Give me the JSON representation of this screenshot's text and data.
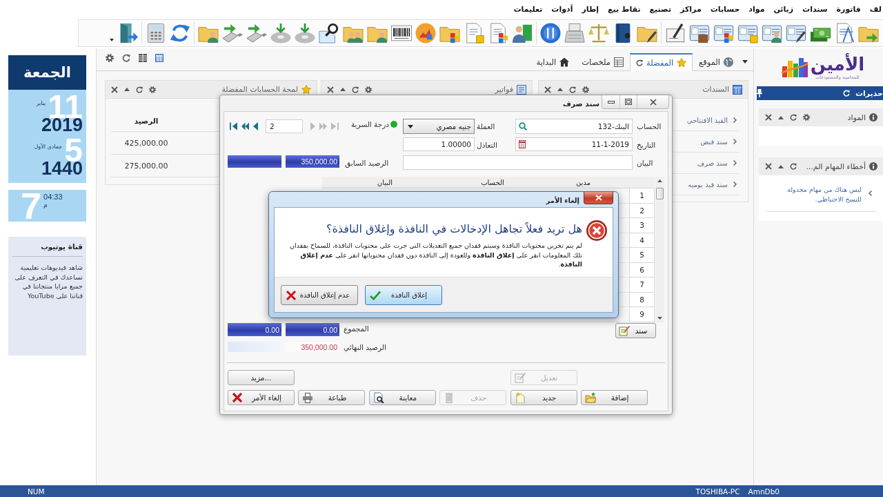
{
  "menu_bar": [
    "لف",
    "فاتورة",
    "سندات",
    "زبائن",
    "مواد",
    "حسابات",
    "مراكز",
    "تصنيع",
    "نقاط بيع",
    "إطار",
    "أدوات",
    "تعليمات"
  ],
  "calendar": {
    "weekday": "الجمعة",
    "gregorian": {
      "month": "يناير",
      "day": "11",
      "year": "2019"
    },
    "hijri": {
      "month": "جمادى الأول",
      "day": "5",
      "year": "1440"
    },
    "time": {
      "hour": "7",
      "clock": "04:33",
      "period": "م"
    }
  },
  "youtube_card": {
    "title": "قناة يوتيوب",
    "text": "شاهد فيديوهات تعليمية تساعدك في التعرف على جميع مزايا منتجاتنا في قناتنا على YouTube"
  },
  "tabs": [
    {
      "label": "الموقع",
      "selected": false
    },
    {
      "label": "المفضلة",
      "selected": true
    },
    {
      "label": "ملخصات",
      "selected": false
    },
    {
      "label": "البداية",
      "selected": false
    }
  ],
  "widgets": [
    {
      "title": "السندات",
      "items": [
        "القيد الافتتاحي",
        "سند قبض",
        "سند صرف",
        "سند قيد يوميه"
      ]
    },
    {
      "title": "فواتير"
    },
    {
      "title": "لمحة الحسابات المفضلة",
      "table": {
        "columns": [
          "الرصيد"
        ],
        "rows": [
          [
            "425,000.00"
          ],
          [
            "275,000.00"
          ]
        ]
      }
    }
  ],
  "sidebar": {
    "logo": {
      "name": "الأمين",
      "tagline": "للمحاسبة والمستودعات"
    },
    "title": "حذيرات",
    "widgets": [
      {
        "title": "المواد"
      },
      {
        "title": "أخطاء المهام الم...",
        "message": "ليس هناك من مهام مجدولة للنسخ الاحتياطي."
      }
    ]
  },
  "voucher_window": {
    "title": "سند صرف",
    "navigation": {
      "record": "2",
      "back_enabled": true,
      "forward_enabled": false
    },
    "secrecy_label": "درجة السرية",
    "account": {
      "label": "الحساب",
      "value": "132-البنك"
    },
    "currency": {
      "label": "العملة",
      "value": "جنيه مصري"
    },
    "date": {
      "label": "التاريخ",
      "value": "11-1-2019"
    },
    "rate": {
      "label": "التعادل",
      "value": "1.00000"
    },
    "description": {
      "label": "البيان"
    },
    "previous_balance": {
      "label": "الرصيد السابق",
      "value": "350,000.00"
    },
    "grid": {
      "columns": [
        "مدين",
        "الحساب",
        "البيان"
      ],
      "row_numbers": [
        "1",
        "2",
        "3",
        "4",
        "5",
        "6",
        "7",
        "8",
        "9"
      ]
    },
    "voucher_button": "سند",
    "total": {
      "label": "المجموع",
      "values": [
        "0.00",
        "0.00"
      ]
    },
    "final_balance": {
      "label": "الرصيد النهائي",
      "value": "350,000.00"
    },
    "buttons": [
      {
        "label": "تعديل",
        "disabled": true
      },
      {
        "label": "مزيد...",
        "disabled": false
      },
      {
        "label": "إضافة",
        "disabled": false
      },
      {
        "label": "جديد",
        "disabled": false
      },
      {
        "label": "حذف",
        "disabled": true
      },
      {
        "label": "معاينة",
        "disabled": false
      },
      {
        "label": "طباعة",
        "disabled": false
      },
      {
        "label": "إلغاء الأمر",
        "disabled": false
      }
    ]
  },
  "confirm_dialog": {
    "title": "إلغاء الأمر",
    "question": "هل تريد فعلاً تجاهل الإدخالات في النافذة وإغلاق النافذة؟",
    "message": "لم يتم تخزين محتويات النافذة وسيتم فقدان جميع التعديلات التي جرت على محتويات النافذة، للسماح بفقدان تلك المعلومات انقر على **إغلاق النافذة** وللعودة إلى النافذة دون فقدان محتوياتها انقر على **عدم إغلاق النافذة**.",
    "buttons": [
      {
        "label": "إغلاق النافذة",
        "highlighted": true
      },
      {
        "label": "عدم إغلاق النافذة",
        "highlighted": false
      }
    ]
  },
  "status_bar": [
    "AmnDb0",
    "TOSHIBA-PC",
    "NUM"
  ]
}
